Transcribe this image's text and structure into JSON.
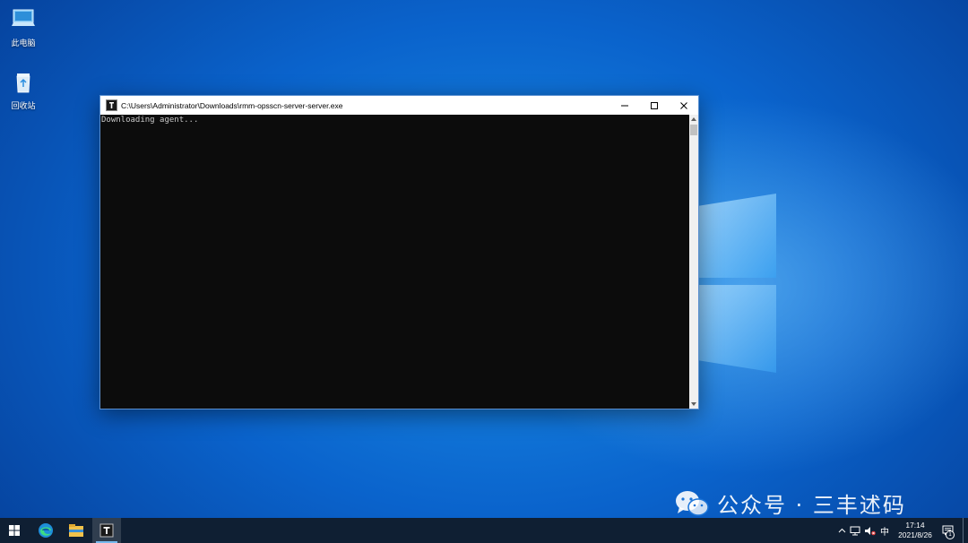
{
  "desktop": {
    "icons": [
      {
        "label": "此电脑",
        "icon": "this-pc-icon"
      },
      {
        "label": "回收站",
        "icon": "recycle-bin-icon"
      }
    ]
  },
  "console": {
    "title": "C:\\Users\\Administrator\\Downloads\\rmm-opsscn-server-server.exe",
    "output": "Downloading agent...",
    "buttons": {
      "minimize": "minimize-icon",
      "maximize": "maximize-icon",
      "close": "close-icon"
    }
  },
  "watermark": {
    "text": "公众号 · 三丰述码"
  },
  "taskbar": {
    "apps": [
      {
        "name": "start-button",
        "icon": "windows-logo-icon"
      },
      {
        "name": "edge-button",
        "icon": "edge-icon"
      },
      {
        "name": "file-explorer-button",
        "icon": "folder-icon"
      },
      {
        "name": "console-taskbar-button",
        "icon": "terminal-icon"
      }
    ],
    "tray": {
      "ime": "中",
      "time": "17:14",
      "date": "2021/8/26",
      "notification_count": "1"
    }
  },
  "colors": {
    "taskbar": "#0f1f33",
    "console_bg": "#0c0c0c",
    "console_text": "#c8c8c8",
    "accent": "#76b9ed"
  }
}
